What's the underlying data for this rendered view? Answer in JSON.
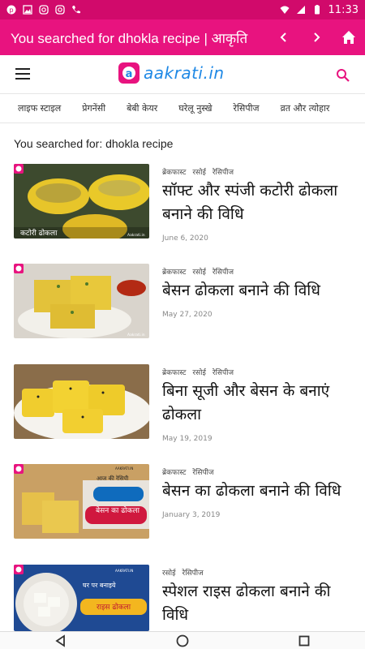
{
  "status_bar": {
    "time": "11:33",
    "icons": [
      "pinterest-icon",
      "image-icon",
      "instagram-icon",
      "instagram-icon",
      "phone-icon",
      "wifi-icon",
      "signal-icon",
      "battery-icon"
    ]
  },
  "app_bar": {
    "title": "You searched for dhokla recipe | आकृति",
    "back_icon": "chevron-left-icon",
    "forward_icon": "chevron-right-icon",
    "home_icon": "home-icon"
  },
  "site_header": {
    "logo_text": "aakrati.in",
    "menu_icon": "hamburger-icon",
    "search_icon": "search-icon"
  },
  "categories": [
    "लाइफ स्टाइल",
    "प्रेगनेंसी",
    "बेबी केयर",
    "घरेलू नुस्खे",
    "रेसिपीज",
    "व्रत और त्योहार"
  ],
  "results": {
    "heading": "You searched for: dhokla recipe",
    "posts": [
      {
        "cats": [
          "ब्रेकफास्ट",
          "रसोई",
          "रेसिपीज"
        ],
        "title": "सॉफ्ट और स्पंजी कटोरी ढोकला बनाने की विधि",
        "date": "June 6, 2020",
        "thumb_caption": "कटोरी ढोकला",
        "thumb_watermark": "Aakrati.in"
      },
      {
        "cats": [
          "ब्रेकफास्ट",
          "रसोई",
          "रेसिपीज"
        ],
        "title": "बेसन ढोकला बनाने की विधि",
        "date": "May 27, 2020",
        "thumb_watermark": "Aakrati.in"
      },
      {
        "cats": [
          "ब्रेकफास्ट",
          "रसोई",
          "रेसिपीज"
        ],
        "title": "बिना सूजी और बेसन के बनाएं ढोकला",
        "date": "May 19, 2019"
      },
      {
        "cats": [
          "ब्रेकफास्ट",
          "रेसिपीज"
        ],
        "title": "बेसन का ढोकला बनाने की विधि",
        "date": "January 3, 2019",
        "thumb_top": "आज की रेसिपी",
        "thumb_caption": "बेसन का ढोकला",
        "thumb_watermark": "AAKRATI.IN"
      },
      {
        "cats": [
          "रसोई",
          "रेसिपीज"
        ],
        "title": "स्पेशल राइस ढोकला बनाने की विधि",
        "date": "",
        "thumb_top": "घर पर बनाइये",
        "thumb_caption": "राइस ढोकला",
        "thumb_watermark": "AAKRATI.IN"
      }
    ]
  },
  "colors": {
    "status_bar": "#d10a6b",
    "app_bar": "#e8137f",
    "logo_blue": "#1e88e5",
    "logo_pink": "#e8137f"
  },
  "nav_bar": {
    "icons": [
      "back-triangle-icon",
      "home-circle-icon",
      "recents-square-icon"
    ]
  }
}
